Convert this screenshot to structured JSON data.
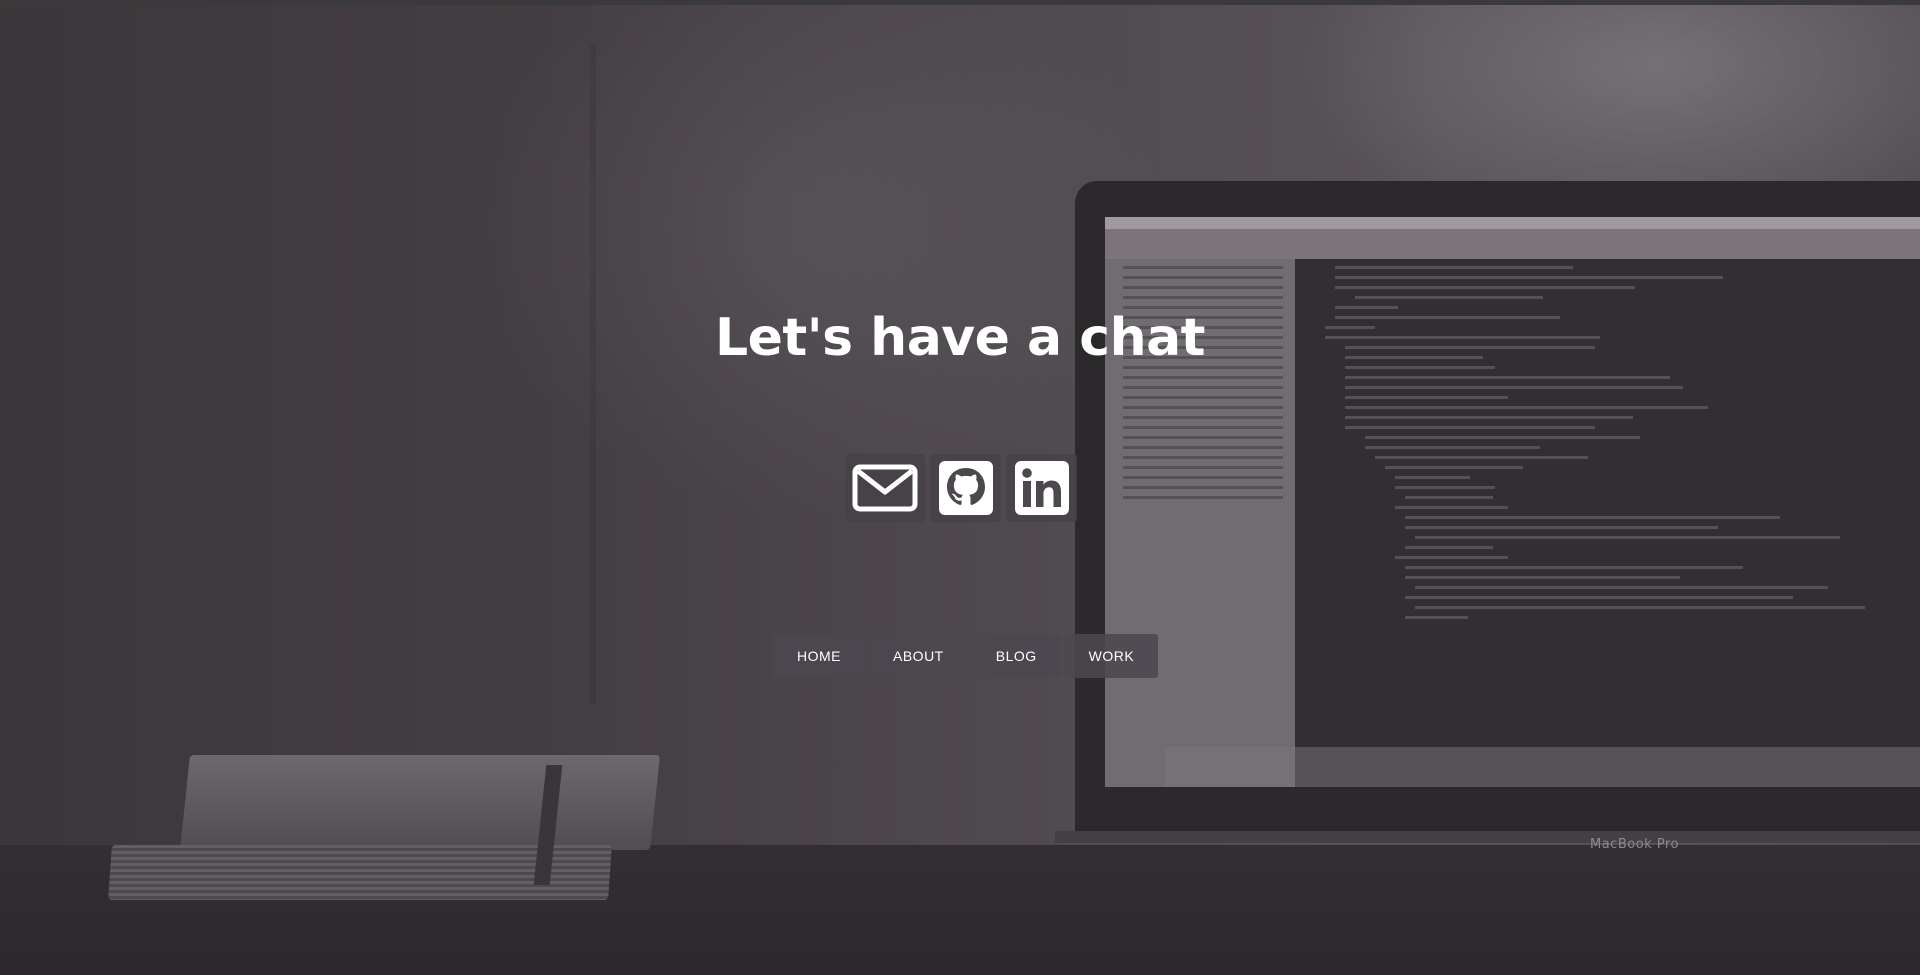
{
  "hero": {
    "title": "Let's have a chat"
  },
  "social": [
    {
      "icon": "envelope-icon"
    },
    {
      "icon": "github-icon"
    },
    {
      "icon": "linkedin-icon"
    }
  ],
  "nav": {
    "items": [
      {
        "label": "HOME"
      },
      {
        "label": "ABOUT"
      },
      {
        "label": "BLOG"
      },
      {
        "label": "WORK"
      }
    ]
  },
  "background": {
    "laptop_label": "MacBook Pro"
  },
  "colors": {
    "text": "#ffffff",
    "button_bg": "#4c484e",
    "overlay": "#3a343a"
  }
}
